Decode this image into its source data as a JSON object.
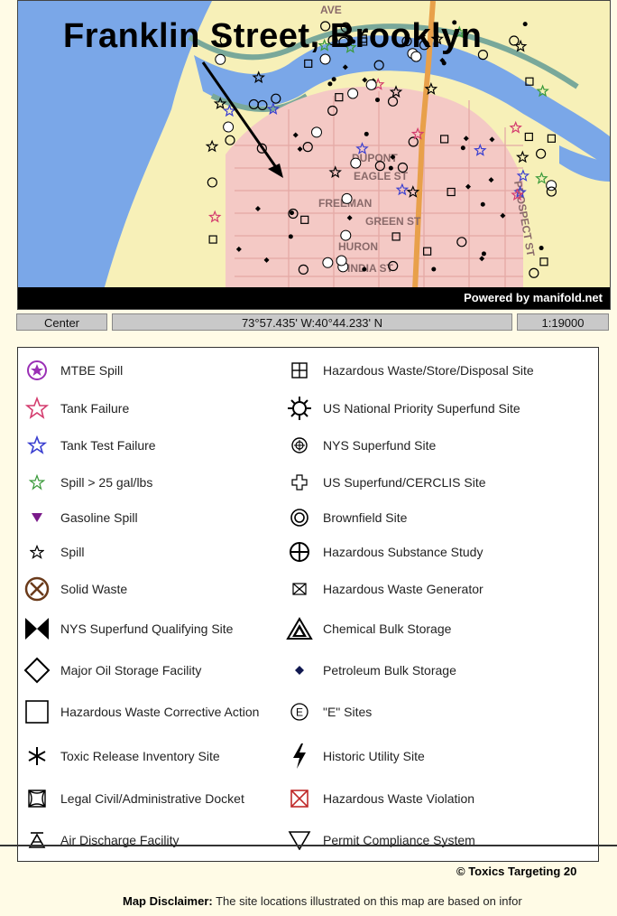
{
  "map": {
    "title": "Franklin Street, Brooklyn",
    "powered_by": "Powered by manifold.net",
    "street_labels": [
      "AVE",
      "DUPONT",
      "EAGLE ST",
      "FREEMAN",
      "GREEN ST",
      "HURON",
      "INDIA ST",
      "PROSPECT ST"
    ],
    "colors": {
      "water": "#7aa7e8",
      "land": "#f7f0b8",
      "urban": "#f4c9c5",
      "park": "#79a89a"
    }
  },
  "status": {
    "center_label": "Center",
    "coordinates": "73°57.435' W:40°44.233' N",
    "scale": "1:19000"
  },
  "legend": {
    "left": [
      {
        "icon": "mtbe-spill-icon",
        "label": "MTBE Spill"
      },
      {
        "icon": "tank-failure-icon",
        "label": "Tank Failure"
      },
      {
        "icon": "tank-test-failure-icon",
        "label": "Tank Test Failure"
      },
      {
        "icon": "spill-over-25-icon",
        "label": "Spill > 25 gal/lbs"
      },
      {
        "icon": "gasoline-spill-icon",
        "label": "Gasoline Spill"
      },
      {
        "icon": "spill-icon",
        "label": "Spill"
      },
      {
        "icon": "solid-waste-icon",
        "label": "Solid Waste"
      },
      {
        "icon": "nys-superfund-qualifying-icon",
        "label": "NYS Superfund Qualifying Site"
      },
      {
        "icon": "major-oil-storage-icon",
        "label": "Major Oil Storage Facility"
      },
      {
        "icon": "hazardous-waste-corrective-icon",
        "label": "Hazardous Waste Corrective Action"
      },
      {
        "icon": "toxic-release-icon",
        "label": "Toxic Release Inventory Site"
      },
      {
        "icon": "legal-docket-icon",
        "label": "Legal Civil/Administrative Docket"
      },
      {
        "icon": "air-discharge-icon",
        "label": "Air Discharge Facility"
      }
    ],
    "right": [
      {
        "icon": "hazardous-waste-store-icon",
        "label": "Hazardous Waste/Store/Disposal Site"
      },
      {
        "icon": "us-national-priority-superfund-icon",
        "label": "US National Priority Superfund Site"
      },
      {
        "icon": "nys-superfund-icon",
        "label": "NYS Superfund Site"
      },
      {
        "icon": "us-superfund-cerclis-icon",
        "label": "US Superfund/CERCLIS Site"
      },
      {
        "icon": "brownfield-icon",
        "label": "Brownfield Site"
      },
      {
        "icon": "hazardous-substance-study-icon",
        "label": "Hazardous Substance Study"
      },
      {
        "icon": "hazardous-waste-generator-icon",
        "label": "Hazardous Waste Generator"
      },
      {
        "icon": "chemical-bulk-storage-icon",
        "label": "Chemical Bulk Storage"
      },
      {
        "icon": "petroleum-bulk-storage-icon",
        "label": "Petroleum Bulk Storage"
      },
      {
        "icon": "e-sites-icon",
        "label": "\"E\" Sites"
      },
      {
        "icon": "historic-utility-icon",
        "label": "Historic Utility Site"
      },
      {
        "icon": "hazardous-waste-violation-icon",
        "label": "Hazardous Waste Violation"
      },
      {
        "icon": "permit-compliance-icon",
        "label": "Permit Compliance System"
      }
    ]
  },
  "footer": {
    "copyright": "© Toxics Targeting 20",
    "disclaimer_label": "Map Disclaimer:",
    "disclaimer_text": " The site locations illustrated on this map are based on infor"
  }
}
